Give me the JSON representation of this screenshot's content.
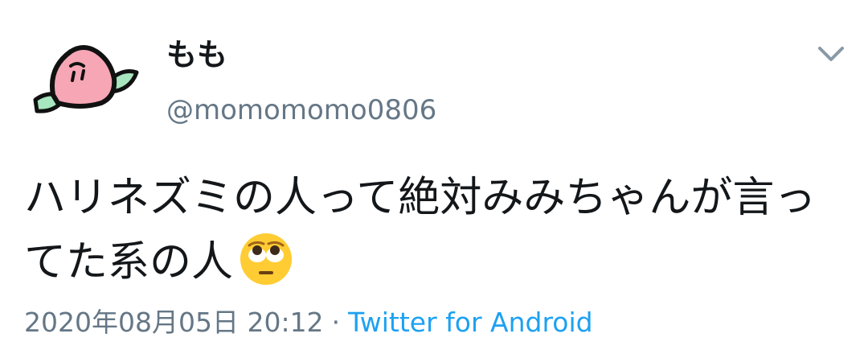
{
  "tweet": {
    "author": {
      "display_name": "もも",
      "handle": "@momomomo0806",
      "avatar_icon": "peach-icon"
    },
    "menu_icon": "chevron-down-icon",
    "text": "ハリネズミの人って絶対みみちゃんが言ってた系の人",
    "emoji": "face-with-rolling-eyes-emoji",
    "timestamp": "2020年08月05日 20:12",
    "separator": "·",
    "client": "Twitter for Android",
    "colors": {
      "text": "#14171a",
      "secondary": "#657786",
      "link": "#1da1f2"
    }
  }
}
